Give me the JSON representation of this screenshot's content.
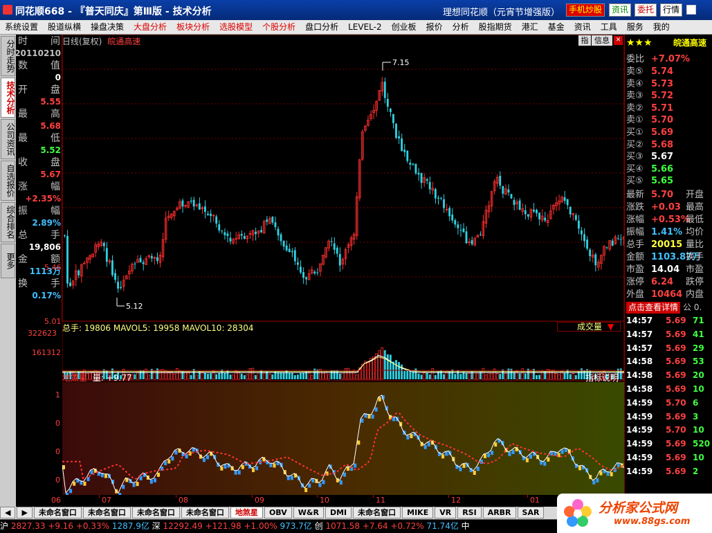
{
  "window": {
    "title": "同花顺668 - 『普天同庆』第Ⅲ版 - 技术分析",
    "subtitle": "理想同花顺（元宵节增强版）",
    "buttons": [
      "手机炒股",
      "资讯",
      "委托",
      "行情"
    ]
  },
  "menu": [
    {
      "label": "系统设置",
      "red": false
    },
    {
      "label": "股道纵横",
      "red": false
    },
    {
      "label": "操盘决策",
      "red": false
    },
    {
      "label": "大盘分析",
      "red": true
    },
    {
      "label": "板块分析",
      "red": true
    },
    {
      "label": "选股模型",
      "red": true
    },
    {
      "label": "个股分析",
      "red": true
    },
    {
      "label": "盘口分析",
      "red": false
    },
    {
      "label": "LEVEL-2",
      "red": false
    },
    {
      "label": "创业板",
      "red": false
    },
    {
      "label": "报价",
      "red": false
    },
    {
      "label": "分析",
      "red": false
    },
    {
      "label": "股指期货",
      "red": false
    },
    {
      "label": "港汇",
      "red": false
    },
    {
      "label": "基金",
      "red": false
    },
    {
      "label": "资讯",
      "red": false
    },
    {
      "label": "工具",
      "red": false
    },
    {
      "label": "服务",
      "red": false
    },
    {
      "label": "我的",
      "red": false
    }
  ],
  "vtabs": [
    "分时走势",
    "技术分析",
    "公司资讯",
    "自选报价",
    "综合排名",
    "更多"
  ],
  "data_panel": [
    {
      "label": "时 间",
      "value": "20110210",
      "color": "#c0c0c0"
    },
    {
      "label": "数 值",
      "value": "0",
      "color": "#fff"
    },
    {
      "label": "开 盘",
      "value": "5.55",
      "color": "#ff4040"
    },
    {
      "label": "最 高",
      "value": "5.68",
      "color": "#ff4040"
    },
    {
      "label": "最 低",
      "value": "5.52",
      "color": "#40ff40"
    },
    {
      "label": "收 盘",
      "value": "5.67",
      "color": "#ff4040"
    },
    {
      "label": "涨 幅",
      "value": "+2.35%",
      "color": "#ff4040"
    },
    {
      "label": "振 幅",
      "value": "2.89%",
      "color": "#40c0ff"
    },
    {
      "label": "总 手",
      "value": "19,806",
      "color": "#fff"
    },
    {
      "label": "金 额",
      "value": "1113万",
      "color": "#40c0ff"
    },
    {
      "label": "换 手",
      "value": "0.17%",
      "color": "#40c0ff"
    }
  ],
  "kline": {
    "period": "日线(复权)",
    "stock": "皖通高速",
    "info_buttons": [
      "指",
      "信息"
    ],
    "high_label": "7.15",
    "low_label": "5.12",
    "left_price": "5.46",
    "bottom_price": "5.01"
  },
  "volume": {
    "header": "总手: 19806 MAVOL5: 19958 MAVOL10: 28304",
    "selector": "成交量",
    "y_labels": [
      "322623",
      "161312"
    ]
  },
  "indicator": {
    "name": "地煞星",
    "value_label": "量: +9.77",
    "help": "指标说明",
    "y_labels": [
      "1",
      "0",
      "0",
      "0",
      "0"
    ]
  },
  "x_axis": [
    "06",
    "07",
    "08",
    "09",
    "10",
    "11",
    "12",
    "01"
  ],
  "right_panel": {
    "stars": "★★★",
    "stock": "皖通高速",
    "ratio": {
      "label": "委比",
      "value": "+7.07%"
    },
    "sells": [
      {
        "label": "卖⑤",
        "price": "5.74"
      },
      {
        "label": "卖④",
        "price": "5.73"
      },
      {
        "label": "卖③",
        "price": "5.72"
      },
      {
        "label": "卖②",
        "price": "5.71"
      },
      {
        "label": "卖①",
        "price": "5.70"
      }
    ],
    "buys": [
      {
        "label": "买①",
        "price": "5.69",
        "color": "#ff4040"
      },
      {
        "label": "买②",
        "price": "5.68",
        "color": "#ff4040"
      },
      {
        "label": "买③",
        "price": "5.67",
        "color": "#fff"
      },
      {
        "label": "买④",
        "price": "5.66",
        "color": "#40ff40"
      },
      {
        "label": "买⑤",
        "price": "5.65",
        "color": "#40ff40"
      }
    ],
    "quote": [
      {
        "label": "最新",
        "value": "5.70",
        "color": "#ff4040",
        "label2": "开盘"
      },
      {
        "label": "涨跌",
        "value": "+0.03",
        "color": "#ff4040",
        "label2": "最高"
      },
      {
        "label": "涨幅",
        "value": "+0.53%",
        "color": "#ff4040",
        "label2": "最低"
      },
      {
        "label": "振幅",
        "value": "1.41%",
        "color": "#40c0ff",
        "label2": "均价"
      },
      {
        "label": "总手",
        "value": "20015",
        "color": "#ffff40",
        "label2": "量比"
      },
      {
        "label": "金额",
        "value": "1103.87万",
        "color": "#40c0ff",
        "label2": "换手"
      },
      {
        "label": "市盈",
        "value": "14.04",
        "color": "#fff",
        "label2": "市盈"
      },
      {
        "label": "涨停",
        "value": "6.24",
        "color": "#ff4040",
        "label2": "跌停"
      },
      {
        "label": "外盘",
        "value": "10464",
        "color": "#ff4040",
        "label2": "内盘"
      }
    ],
    "detail_button": "点击查看详情",
    "detail_tail": "公 0.",
    "ticks": [
      {
        "time": "14:57",
        "price": "5.69",
        "color": "#ff4040",
        "vol": "71"
      },
      {
        "time": "14:57",
        "price": "5.69",
        "color": "#ff4040",
        "vol": "41"
      },
      {
        "time": "14:57",
        "price": "5.69",
        "color": "#ff4040",
        "vol": "29"
      },
      {
        "time": "14:58",
        "price": "5.69",
        "color": "#ff4040",
        "vol": "53"
      },
      {
        "time": "14:58",
        "price": "5.69",
        "color": "#ff4040",
        "vol": "20"
      },
      {
        "time": "14:58",
        "price": "5.69",
        "color": "#ff4040",
        "vol": "10"
      },
      {
        "time": "14:59",
        "price": "5.70",
        "color": "#ff4040",
        "vol": "6"
      },
      {
        "time": "14:59",
        "price": "5.69",
        "color": "#ff4040",
        "vol": "3"
      },
      {
        "time": "14:59",
        "price": "5.70",
        "color": "#ff4040",
        "vol": "10"
      },
      {
        "time": "14:59",
        "price": "5.69",
        "color": "#ff4040",
        "vol": "520"
      },
      {
        "time": "14:59",
        "price": "5.69",
        "color": "#ff4040",
        "vol": "10"
      },
      {
        "time": "14:59",
        "price": "5.69",
        "color": "#ff4040",
        "vol": "2"
      }
    ]
  },
  "bottom_tabs": [
    "◀",
    "▶",
    "未命名窗口",
    "未命名窗口",
    "未命名窗口",
    "未命名窗口",
    "地煞星",
    "OBV",
    "W&R",
    "DMI",
    "未命名窗口",
    "MIKE",
    "VR",
    "RSI",
    "ARBR",
    "SAR"
  ],
  "status": [
    {
      "text": "沪",
      "color": "#fff"
    },
    {
      "text": "2827.33",
      "color": "#ff4040"
    },
    {
      "text": "+9.16",
      "color": "#ff4040"
    },
    {
      "text": "+0.33%",
      "color": "#ff4040"
    },
    {
      "text": "1287.9亿",
      "color": "#40c0ff"
    },
    {
      "text": "深",
      "color": "#fff"
    },
    {
      "text": "12292.49",
      "color": "#ff4040"
    },
    {
      "text": "+121.98",
      "color": "#ff4040"
    },
    {
      "text": "+1.00%",
      "color": "#ff4040"
    },
    {
      "text": "973.7亿",
      "color": "#40c0ff"
    },
    {
      "text": "创",
      "color": "#fff"
    },
    {
      "text": "1071.58",
      "color": "#ff4040"
    },
    {
      "text": "+7.64",
      "color": "#ff4040"
    },
    {
      "text": "+0.72%",
      "color": "#ff4040"
    },
    {
      "text": "71.74亿",
      "color": "#40c0ff"
    },
    {
      "text": "中",
      "color": "#fff"
    }
  ],
  "brand": {
    "name": "分析家公式网",
    "url": "www.88gs.com"
  },
  "colors": {
    "up": "#ff3030",
    "down": "#30d0e0",
    "grid": "#800000",
    "ma": "#ffffff"
  }
}
